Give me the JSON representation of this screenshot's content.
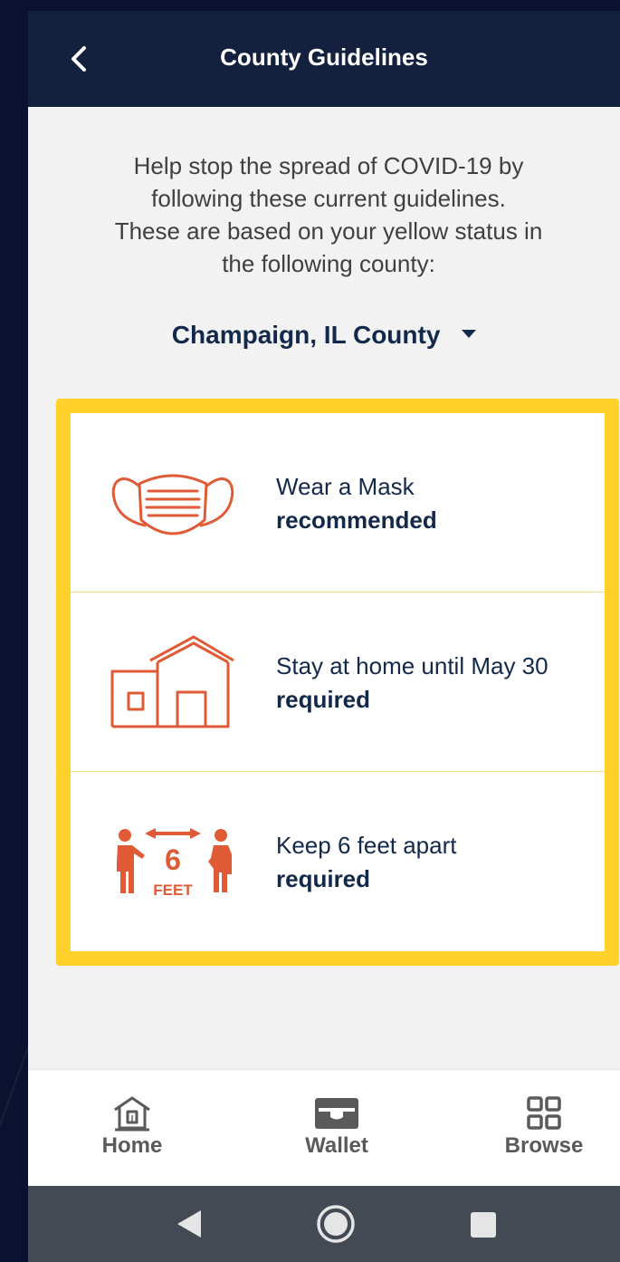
{
  "header": {
    "title": "County Guidelines"
  },
  "intro": {
    "line1": "Help stop the spread of COVID-19 by",
    "line2": "following these current guidelines.",
    "line3": "These are based on your yellow status in",
    "line4": "the following county:"
  },
  "county": {
    "selected": "Champaign, IL County"
  },
  "status_color": "#ffd12a",
  "icon_color": "#e05a35",
  "guidelines": [
    {
      "icon": "mask-icon",
      "title": "Wear a Mask",
      "status": "recommended"
    },
    {
      "icon": "house-icon",
      "title": "Stay at home until May 30",
      "status": "required"
    },
    {
      "icon": "distance-icon",
      "title": "Keep 6 feet apart",
      "status": "required",
      "icon_number": "6",
      "icon_unit": "FEET"
    }
  ],
  "bottom_nav": {
    "home": "Home",
    "wallet": "Wallet",
    "browse": "Browse"
  },
  "system_nav": [
    "back-triangle-icon",
    "home-circle-icon",
    "recents-square-icon"
  ]
}
